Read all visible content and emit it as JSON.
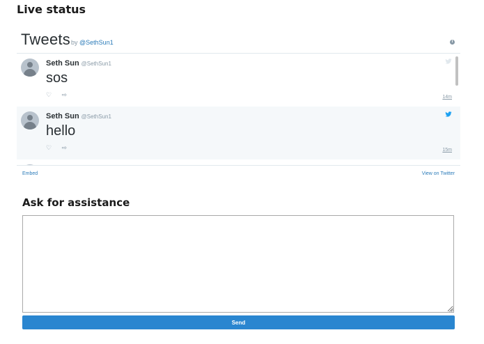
{
  "page": {
    "title": "Live status"
  },
  "widget": {
    "title": "Tweets",
    "by": "by",
    "handle": "@SethSun1",
    "embed": "Embed",
    "view": "View on Twitter",
    "accent_color": "#2b7bb9",
    "tweets": [
      {
        "name": "Seth Sun",
        "handle": "@SethSun1",
        "text": "sos",
        "time": "14m",
        "icon": "bird-icon"
      },
      {
        "name": "Seth Sun",
        "handle": "@SethSun1",
        "text": "hello",
        "time": "15m",
        "icon": "bird-icon"
      }
    ]
  },
  "assistance": {
    "title": "Ask for assistance",
    "textarea_value": "",
    "send": "Send",
    "button_color": "#2a86d0"
  }
}
